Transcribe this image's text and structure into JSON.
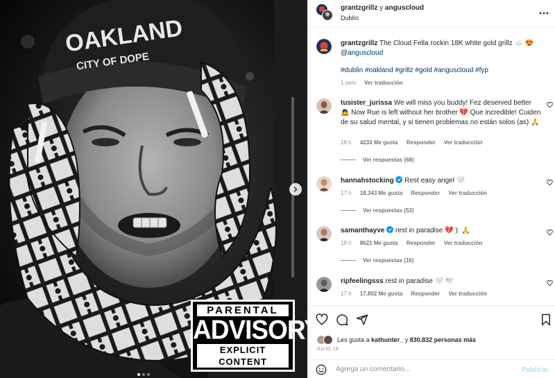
{
  "post": {
    "header": {
      "author": "grantzgrillz",
      "connector": "y",
      "coauthor": "anguscloud",
      "location": "Dublín"
    },
    "caption": {
      "username": "grantzgrillz",
      "text": "The Cloud Fella rockin 18K white gold grillz",
      "emojis": "☁️ 😍",
      "mention": "@anguscloud",
      "hashtags": "#dublin #oakland #grillz #gold #anguscloud #fyp",
      "time": "1 sem",
      "translate": "Ver traducción"
    },
    "media": {
      "overlay_line1": "PARENTAL",
      "overlay_line2": "ADVISORY",
      "overlay_line3": "EXPLICIT CONTENT",
      "hat_text": "OAKLAND",
      "hat_subtext": "CITY OF DOPE",
      "carousel_count": 3,
      "carousel_active": 1
    },
    "comments": [
      {
        "username": "tusister_jurissa",
        "text": "We will miss you buddy! Fez deserved better 🙇 Now Rue is left without her brother 💔 Que incredible! Cuiden de su salud mental, y si tienen problemas no están solos (as) 🙏",
        "time": "18 h",
        "likes": "4233 Me gusta",
        "reply": "Responder",
        "translate": "Ver traducción",
        "replies": "Ver respuestas (68)",
        "verified": false
      },
      {
        "username": "hannahstocking",
        "text": "Rest easy angel 🤍",
        "time": "17 h",
        "likes": "18.343 Me gusta",
        "reply": "Responder",
        "translate": "Ver traducción",
        "replies": "Ver respuestas (53)",
        "verified": true
      },
      {
        "username": "samanthayve",
        "text": "rest in paradise 💔 ): 🙏",
        "time": "18 h",
        "likes": "8621 Me gusta",
        "reply": "Responder",
        "translate": "Ver traducción",
        "replies": "Ver respuestas (16)",
        "verified": true
      },
      {
        "username": "ripfeelingsss",
        "text": "rest in paradise 🤍 🕊️",
        "time": "17 h",
        "likes": "17.802 Me gusta",
        "reply": "Responder",
        "translate": "Ver traducción",
        "verified": false
      }
    ],
    "likes": {
      "prefix": "Les gusta a",
      "user": "kathunter_",
      "connector": "y",
      "count": "830.832 personas más"
    },
    "date": "JULIO 18",
    "add_comment": {
      "placeholder": "Agrega un comentario...",
      "publish": "Publicar"
    },
    "icons": {
      "like": "heart-icon",
      "comment": "comment-icon",
      "share": "send-icon",
      "save": "bookmark-icon",
      "more": "more-icon",
      "emoji": "smiley-icon",
      "next": "chevron-right-icon"
    },
    "colors": {
      "link": "#00376b",
      "muted": "#8e8e8e",
      "verified": "#0095f6",
      "publish_disabled": "#b2dffc"
    }
  }
}
